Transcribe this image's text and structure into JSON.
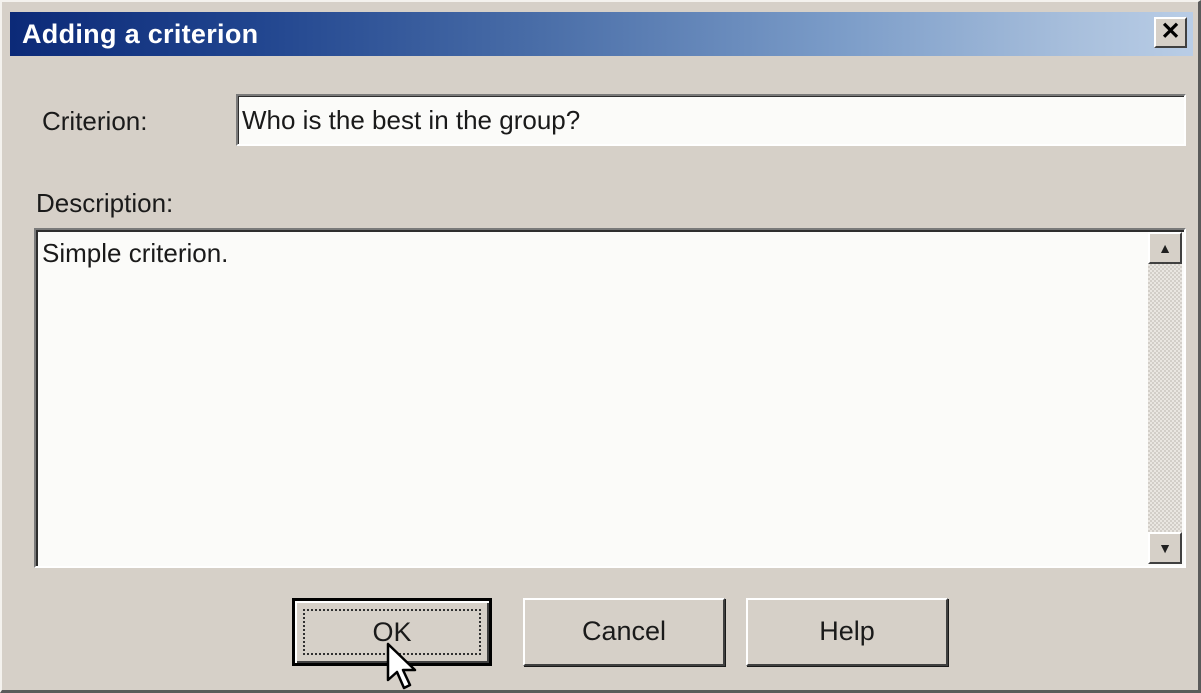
{
  "window": {
    "title": "Adding a criterion",
    "close_symbol": "✕"
  },
  "form": {
    "criterion_label": "Criterion:",
    "criterion_value": "Who is the best in the group?",
    "description_label": "Description:",
    "description_value": "Simple criterion."
  },
  "buttons": {
    "ok_label": "OK",
    "cancel_label": "Cancel",
    "help_label": "Help"
  },
  "scrollbar": {
    "up_symbol": "▲",
    "down_symbol": "▼"
  },
  "icons": {
    "close": "close-icon",
    "scroll_up": "scroll-up-arrow-icon",
    "scroll_down": "scroll-down-arrow-icon",
    "cursor": "mouse-pointer-icon"
  },
  "colors": {
    "dialog_face": "#d6d0c8",
    "title_gradient_start": "#0c2a78",
    "title_gradient_end": "#b9cde6",
    "field_background": "#fbfbf9"
  }
}
